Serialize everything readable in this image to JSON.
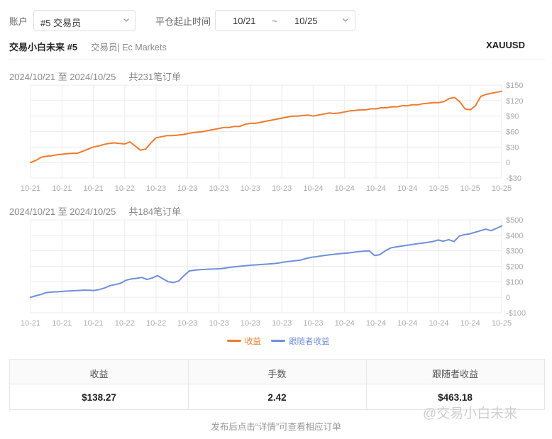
{
  "filters": {
    "account_label": "账户",
    "account_value": "#5 交易员",
    "time_label": "平仓起止时间",
    "date_start": "10/21",
    "date_sep": "~",
    "date_end": "10/25"
  },
  "trader": {
    "name": "交易小白未来 #5",
    "subtitle": "交易员| Ec Markets",
    "symbol": "XAUUSD"
  },
  "charts": [
    {
      "range": "2024/10/21 至 2024/10/25",
      "count": "共231笔订单"
    },
    {
      "range": "2024/10/21 至 2024/10/25",
      "count": "共184笔订单"
    }
  ],
  "chart_data": [
    {
      "type": "line",
      "series": [
        {
          "name": "收益",
          "color": "#f07a2a",
          "values": [
            0,
            4,
            10,
            12,
            13,
            15,
            16,
            17,
            18,
            18,
            22,
            26,
            30,
            32,
            35,
            37,
            38,
            37,
            36,
            40,
            32,
            24,
            26,
            38,
            48,
            50,
            52,
            52,
            53,
            54,
            56,
            58,
            59,
            60,
            62,
            64,
            66,
            68,
            68,
            70,
            70,
            74,
            76,
            76,
            78,
            80,
            82,
            84,
            86,
            88,
            90,
            90,
            91,
            92,
            90,
            92,
            94,
            96,
            95,
            96,
            98,
            100,
            101,
            102,
            102,
            104,
            104,
            106,
            106,
            108,
            108,
            110,
            110,
            112,
            112,
            114,
            115,
            116,
            116,
            118,
            124,
            126,
            118,
            104,
            102,
            110,
            128,
            132,
            134,
            136,
            138
          ]
        }
      ],
      "x_tick_labels": [
        "10-21",
        "10-21",
        "10-21",
        "10-22",
        "10-23",
        "10-23",
        "10-23",
        "10-23",
        "10-23",
        "10-24",
        "10-24",
        "10-24",
        "10-24",
        "10-25",
        "10-25",
        "10-25"
      ],
      "y_ticks": [
        "$150",
        "$120",
        "$90",
        "$60",
        "$30",
        "0",
        "-$30"
      ],
      "ylim": [
        -30,
        150
      ],
      "grid": true
    },
    {
      "type": "line",
      "series": [
        {
          "name": "跟随者收益",
          "color": "#6f8fdb",
          "values": [
            0,
            10,
            18,
            30,
            34,
            35,
            38,
            40,
            42,
            44,
            46,
            45,
            44,
            50,
            60,
            75,
            82,
            90,
            110,
            118,
            122,
            128,
            115,
            125,
            140,
            120,
            100,
            95,
            105,
            140,
            170,
            175,
            178,
            180,
            182,
            183,
            185,
            190,
            195,
            198,
            202,
            205,
            208,
            210,
            213,
            215,
            218,
            222,
            228,
            232,
            236,
            240,
            250,
            258,
            262,
            268,
            272,
            276,
            280,
            284,
            286,
            290,
            295,
            298,
            300,
            270,
            275,
            300,
            318,
            325,
            330,
            335,
            340,
            345,
            350,
            355,
            360,
            370,
            362,
            372,
            360,
            395,
            405,
            410,
            420,
            430,
            440,
            430,
            445,
            460
          ]
        }
      ],
      "x_tick_labels": [
        "10-21",
        "10-21",
        "10-21",
        "10-22",
        "10-22",
        "10-23",
        "10-23",
        "10-23",
        "10-23",
        "10-23",
        "10-24",
        "10-24",
        "10-24",
        "10-24",
        "10-24",
        "10-25"
      ],
      "y_ticks": [
        "$500",
        "$400",
        "$300",
        "$200",
        "$100",
        "0",
        "-$100"
      ],
      "ylim": [
        -100,
        500
      ],
      "grid": true
    }
  ],
  "legend": {
    "items": [
      {
        "label": "收益",
        "color": "#f07a2a"
      },
      {
        "label": "跟随者收益",
        "color": "#6f8fdb"
      }
    ],
    "placement": "bottom-center"
  },
  "stats": {
    "headers": [
      "收益",
      "手数",
      "跟随者收益"
    ],
    "values": [
      "$138.27",
      "2.42",
      "$463.18"
    ]
  },
  "footer_hint": "发布后点击“详情”可查看相应订单",
  "watermark": "@交易小白未来"
}
